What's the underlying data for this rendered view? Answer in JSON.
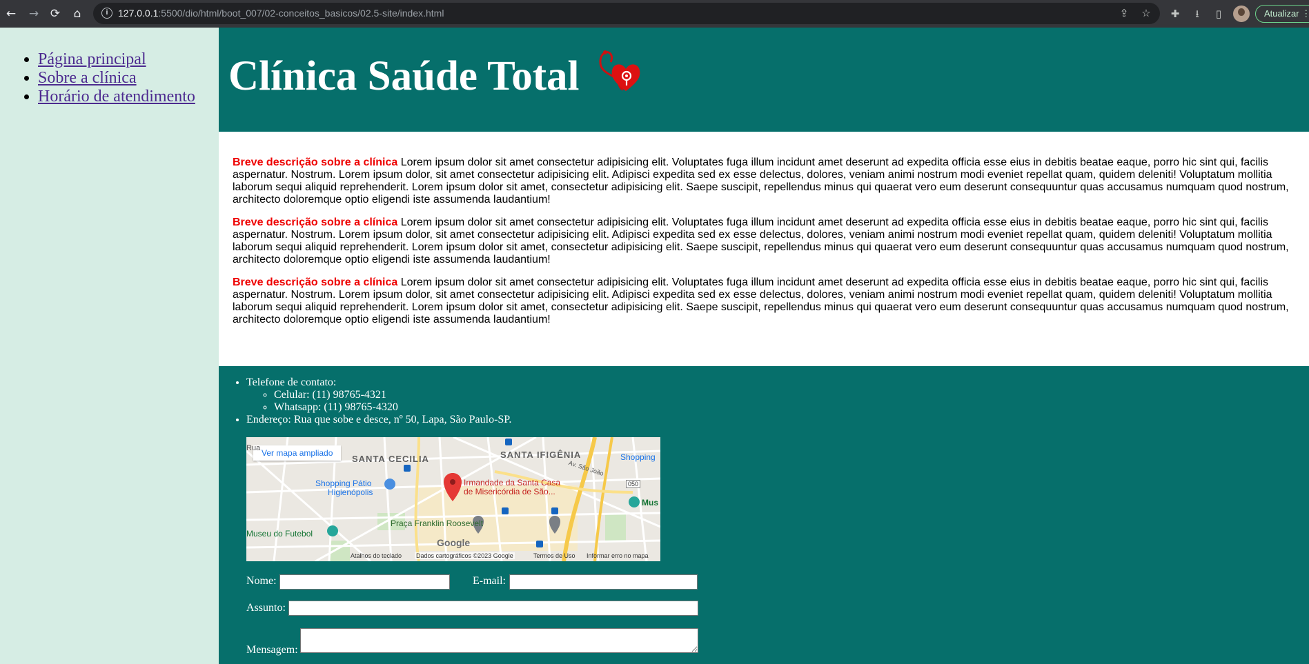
{
  "browser": {
    "url_host": "127.0.0.1",
    "url_path": ":5500/dio/html/boot_007/02-conceitos_basicos/02.5-site/index.html",
    "update_label": "Atualizar"
  },
  "nav": {
    "items": [
      {
        "label": "Página principal"
      },
      {
        "label": "Sobre a clínica"
      },
      {
        "label": "Horário de atendimento"
      }
    ],
    "link_color": "#4c2a8f"
  },
  "header": {
    "title": "Clínica Saúde Total",
    "background": "#066f6b"
  },
  "main": {
    "paragraphs": [
      {
        "lead": "Breve descrição sobre a clínica",
        "text": " Lorem ipsum dolor sit amet consectetur adipisicing elit. Voluptates fuga illum incidunt amet deserunt ad expedita officia esse eius in debitis beatae eaque, porro hic sint qui, facilis aspernatur. Nostrum. Lorem ipsum dolor, sit amet consectetur adipisicing elit. Adipisci expedita sed ex esse delectus, dolores, veniam animi nostrum modi eveniet repellat quam, quidem deleniti! Voluptatum mollitia laborum sequi aliquid reprehenderit. Lorem ipsum dolor sit amet, consectetur adipisicing elit. Saepe suscipit, repellendus minus qui quaerat vero eum deserunt consequuntur quas accusamus numquam quod nostrum, architecto doloremque optio eligendi iste assumenda laudantium!"
      },
      {
        "lead": "Breve descrição sobre a clínica",
        "text": " Lorem ipsum dolor sit amet consectetur adipisicing elit. Voluptates fuga illum incidunt amet deserunt ad expedita officia esse eius in debitis beatae eaque, porro hic sint qui, facilis aspernatur. Nostrum. Lorem ipsum dolor, sit amet consectetur adipisicing elit. Adipisci expedita sed ex esse delectus, dolores, veniam animi nostrum modi eveniet repellat quam, quidem deleniti! Voluptatum mollitia laborum sequi aliquid reprehenderit. Lorem ipsum dolor sit amet, consectetur adipisicing elit. Saepe suscipit, repellendus minus qui quaerat vero eum deserunt consequuntur quas accusamus numquam quod nostrum, architecto doloremque optio eligendi iste assumenda laudantium!"
      },
      {
        "lead": "Breve descrição sobre a clínica",
        "text": " Lorem ipsum dolor sit amet consectetur adipisicing elit. Voluptates fuga illum incidunt amet deserunt ad expedita officia esse eius in debitis beatae eaque, porro hic sint qui, facilis aspernatur. Nostrum. Lorem ipsum dolor, sit amet consectetur adipisicing elit. Adipisci expedita sed ex esse delectus, dolores, veniam animi nostrum modi eveniet repellat quam, quidem deleniti! Voluptatum mollitia laborum sequi aliquid reprehenderit. Lorem ipsum dolor sit amet, consectetur adipisicing elit. Saepe suscipit, repellendus minus qui quaerat vero eum deserunt consequuntur quas accusamus numquam quod nostrum, architecto doloremque optio eligendi iste assumenda laudantium!"
      }
    ],
    "lead_color": "#ee0000"
  },
  "footer": {
    "phone_label": "Telefone de contato:",
    "cell": "Celular: (11) 98765-4321",
    "whatsapp": "Whatsapp: (11) 98765-4320",
    "address": "Endereço: Rua que sobe e desce, nº 50, Lapa, São Paulo-SP."
  },
  "map": {
    "link_label": "Ver mapa ampliado",
    "labels": {
      "santa_cecilia": "SANTA CECILIA",
      "santa_ifigenia": "SANTA IFIGÊNIA",
      "shopping_patio": "Shopping Pátio",
      "higienopolis": "Higienópolis",
      "irmandade1": "Irmandade da Santa Casa",
      "irmandade2": "de Misericórdia de São...",
      "praca": "Praça Franklin Roosevelt",
      "museu": "Museu do Futebol",
      "shopping": "Shopping",
      "mus": "Mus",
      "av_sao_joao": "Av. São João",
      "road_050": "050",
      "rua": "Rua",
      "google": "Google"
    },
    "footer": {
      "keyboard": "Atalhos do teclado",
      "data": "Dados cartográficos ©2023 Google",
      "terms": "Termos de Uso",
      "report": "Informar erro no mapa"
    }
  },
  "form": {
    "name_label": "Nome:",
    "email_label": "E-mail:",
    "subject_label": "Assunto:",
    "message_label": "Mensagem:",
    "name_value": "",
    "email_value": "",
    "subject_value": "",
    "message_value": ""
  }
}
